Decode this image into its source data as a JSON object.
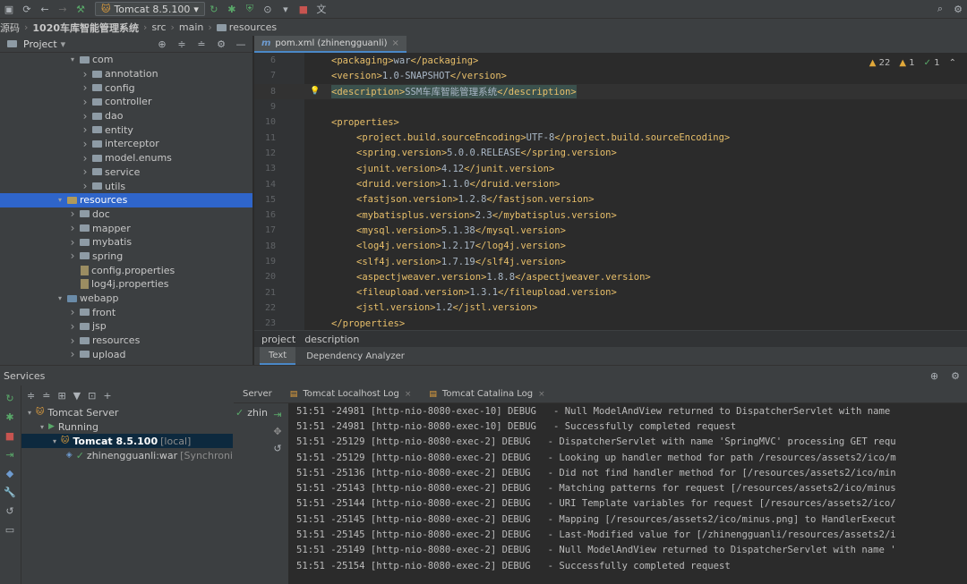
{
  "toolbar": {
    "run_config": "Tomcat 8.5.100"
  },
  "navbar": {
    "crumbs": [
      "源码",
      "1020车库智能管理系统",
      "src",
      "main",
      "resources"
    ]
  },
  "project_panel": {
    "title": "Project",
    "tree": [
      {
        "label": "com",
        "indent": 5,
        "expanded": true,
        "kind": "folder"
      },
      {
        "label": "annotation",
        "indent": 6,
        "kind": "folder"
      },
      {
        "label": "config",
        "indent": 6,
        "kind": "folder"
      },
      {
        "label": "controller",
        "indent": 6,
        "kind": "folder"
      },
      {
        "label": "dao",
        "indent": 6,
        "kind": "folder"
      },
      {
        "label": "entity",
        "indent": 6,
        "kind": "folder"
      },
      {
        "label": "interceptor",
        "indent": 6,
        "kind": "folder"
      },
      {
        "label": "model.enums",
        "indent": 6,
        "kind": "folder"
      },
      {
        "label": "service",
        "indent": 6,
        "kind": "folder"
      },
      {
        "label": "utils",
        "indent": 6,
        "kind": "folder"
      },
      {
        "label": "resources",
        "indent": 4,
        "expanded": true,
        "kind": "res",
        "selected": true
      },
      {
        "label": "doc",
        "indent": 5,
        "kind": "folder"
      },
      {
        "label": "mapper",
        "indent": 5,
        "kind": "folder"
      },
      {
        "label": "mybatis",
        "indent": 5,
        "kind": "folder"
      },
      {
        "label": "spring",
        "indent": 5,
        "kind": "folder"
      },
      {
        "label": "config.properties",
        "indent": 5,
        "kind": "file"
      },
      {
        "label": "log4j.properties",
        "indent": 5,
        "kind": "file"
      },
      {
        "label": "webapp",
        "indent": 4,
        "expanded": true,
        "kind": "web"
      },
      {
        "label": "front",
        "indent": 5,
        "kind": "folder"
      },
      {
        "label": "jsp",
        "indent": 5,
        "kind": "folder"
      },
      {
        "label": "resources",
        "indent": 5,
        "kind": "folder"
      },
      {
        "label": "upload",
        "indent": 5,
        "kind": "folder"
      }
    ]
  },
  "editor": {
    "tab_label": "pom.xml (zhinengguanli)",
    "inspections": {
      "warnings": "22",
      "weak": "1",
      "ok": "1"
    },
    "lines": [
      {
        "n": "6",
        "open": "<packaging>",
        "value": "war",
        "close": "</packaging>",
        "indent": false
      },
      {
        "n": "7",
        "open": "<version>",
        "value": "1.0-SNAPSHOT",
        "close": "</version>",
        "indent": false
      },
      {
        "n": "8",
        "open": "<description>",
        "value": "SSM车库智能管理系统",
        "close": "</description>",
        "indent": false,
        "current": true
      },
      {
        "n": "9",
        "open": "",
        "value": "",
        "close": "",
        "indent": false
      },
      {
        "n": "10",
        "open": "<properties>",
        "value": "",
        "close": "",
        "indent": false
      },
      {
        "n": "11",
        "open": "<project.build.sourceEncoding>",
        "value": "UTF-8",
        "close": "</project.build.sourceEncoding>",
        "indent": true
      },
      {
        "n": "12",
        "open": "<spring.version>",
        "value": "5.0.0.RELEASE",
        "close": "</spring.version>",
        "indent": true
      },
      {
        "n": "13",
        "open": "<junit.version>",
        "value": "4.12",
        "close": "</junit.version>",
        "indent": true
      },
      {
        "n": "14",
        "open": "<druid.version>",
        "value": "1.1.0",
        "close": "</druid.version>",
        "indent": true
      },
      {
        "n": "15",
        "open": "<fastjson.version>",
        "value": "1.2.8",
        "close": "</fastjson.version>",
        "indent": true
      },
      {
        "n": "16",
        "open": "<mybatisplus.version>",
        "value": "2.3",
        "close": "</mybatisplus.version>",
        "indent": true
      },
      {
        "n": "17",
        "open": "<mysql.version>",
        "value": "5.1.38",
        "close": "</mysql.version>",
        "indent": true
      },
      {
        "n": "18",
        "open": "<log4j.version>",
        "value": "1.2.17",
        "close": "</log4j.version>",
        "indent": true
      },
      {
        "n": "19",
        "open": "<slf4j.version>",
        "value": "1.7.19",
        "close": "</slf4j.version>",
        "indent": true
      },
      {
        "n": "20",
        "open": "<aspectjweaver.version>",
        "value": "1.8.8",
        "close": "</aspectjweaver.version>",
        "indent": true
      },
      {
        "n": "21",
        "open": "<fileupload.version>",
        "value": "1.3.1",
        "close": "</fileupload.version>",
        "indent": true
      },
      {
        "n": "22",
        "open": "<jstl.version>",
        "value": "1.2",
        "close": "</jstl.version>",
        "indent": true
      },
      {
        "n": "23",
        "open": "</properties>",
        "value": "",
        "close": "",
        "indent": false
      }
    ],
    "breadcrumb": [
      "project",
      "description"
    ],
    "bottom_tabs": [
      "Text",
      "Dependency Analyzer"
    ]
  },
  "services": {
    "title": "Services",
    "tree": [
      {
        "label": "Tomcat Server",
        "extra": "",
        "indent": 0
      },
      {
        "label": "Running",
        "extra": "",
        "indent": 1
      },
      {
        "label": "Tomcat 8.5.100",
        "extra": "[local]",
        "indent": 2,
        "selected": true
      },
      {
        "label": "zhinengguanli:war",
        "extra": "[Synchroni",
        "indent": 3
      }
    ],
    "console_tabs": [
      "Server",
      "Tomcat Localhost Log",
      "Tomcat Catalina Log"
    ],
    "status_label": "zhin",
    "log_lines": [
      "51:51 -24981 [http-nio-8080-exec-10] DEBUG   - Null ModelAndView returned to DispatcherServlet with name",
      "51:51 -24981 [http-nio-8080-exec-10] DEBUG   - Successfully completed request",
      "51:51 -25129 [http-nio-8080-exec-2] DEBUG   - DispatcherServlet with name 'SpringMVC' processing GET requ",
      "51:51 -25129 [http-nio-8080-exec-2] DEBUG   - Looking up handler method for path /resources/assets2/ico/m",
      "51:51 -25136 [http-nio-8080-exec-2] DEBUG   - Did not find handler method for [/resources/assets2/ico/min",
      "51:51 -25143 [http-nio-8080-exec-2] DEBUG   - Matching patterns for request [/resources/assets2/ico/minus",
      "51:51 -25144 [http-nio-8080-exec-2] DEBUG   - URI Template variables for request [/resources/assets2/ico/",
      "51:51 -25145 [http-nio-8080-exec-2] DEBUG   - Mapping [/resources/assets2/ico/minus.png] to HandlerExecut",
      "51:51 -25145 [http-nio-8080-exec-2] DEBUG   - Last-Modified value for [/zhinengguanli/resources/assets2/i",
      "51:51 -25149 [http-nio-8080-exec-2] DEBUG   - Null ModelAndView returned to DispatcherServlet with name '",
      "51:51 -25154 [http-nio-8080-exec-2] DEBUG   - Successfully completed request"
    ]
  }
}
